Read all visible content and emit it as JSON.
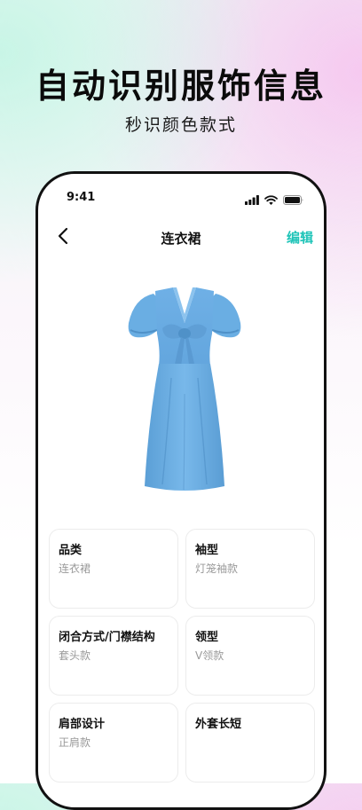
{
  "hero": {
    "title": "自动识别服饰信息",
    "subtitle": "秒识颜色款式"
  },
  "status_bar": {
    "time": "9:41"
  },
  "nav": {
    "title": "连衣裙",
    "edit_label": "编辑"
  },
  "colors": {
    "accent": "#1fc4b8",
    "dress": "#6aaee3"
  },
  "attributes": [
    {
      "label": "品类",
      "value": "连衣裙"
    },
    {
      "label": "袖型",
      "value": "灯笼袖款"
    },
    {
      "label": "闭合方式/门襟结构",
      "value": "套头款"
    },
    {
      "label": "领型",
      "value": "V领款"
    },
    {
      "label": "肩部设计",
      "value": "正肩款"
    },
    {
      "label": "外套长短",
      "value": ""
    }
  ]
}
